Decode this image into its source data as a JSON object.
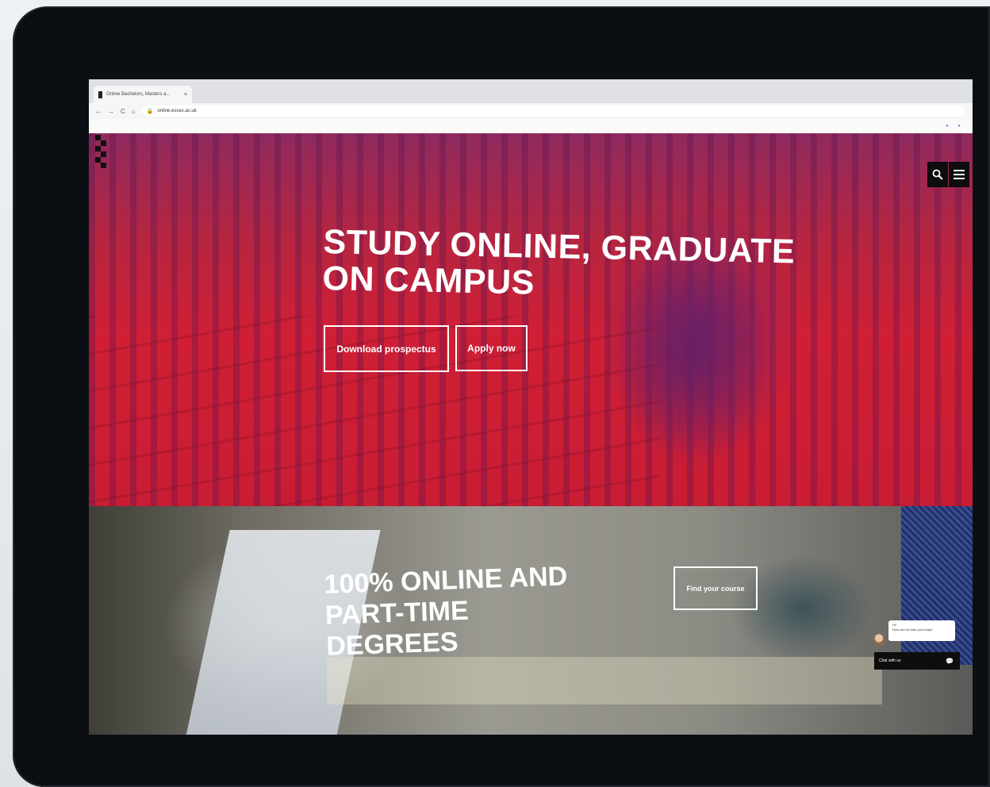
{
  "browser": {
    "tab_title": "Online Bachelors, Masters a...",
    "tab_close": "×",
    "url": "online.essex.ac.uk",
    "nav_back": "←",
    "nav_forward": "→",
    "nav_reload": "C",
    "nav_home": "⌂",
    "lock": "🔒"
  },
  "header": {
    "search_icon": "search-icon",
    "menu_icon": "menu-icon"
  },
  "hero": {
    "title": "STUDY ONLINE, GRADUATE ON CAMPUS",
    "download_label": "Download prospectus",
    "apply_label": "Apply now"
  },
  "online_section": {
    "title": "100% ONLINE AND PART-TIME DEGREES",
    "find_label": "Find your course"
  },
  "chat": {
    "greeting": "Hi!",
    "question": "How can we help you today?",
    "bar_label": "Chat with us"
  },
  "colors": {
    "hero_red": "#d01f35",
    "hero_purple": "#8f2a5e",
    "monitor_bezel": "#0b0f13"
  }
}
